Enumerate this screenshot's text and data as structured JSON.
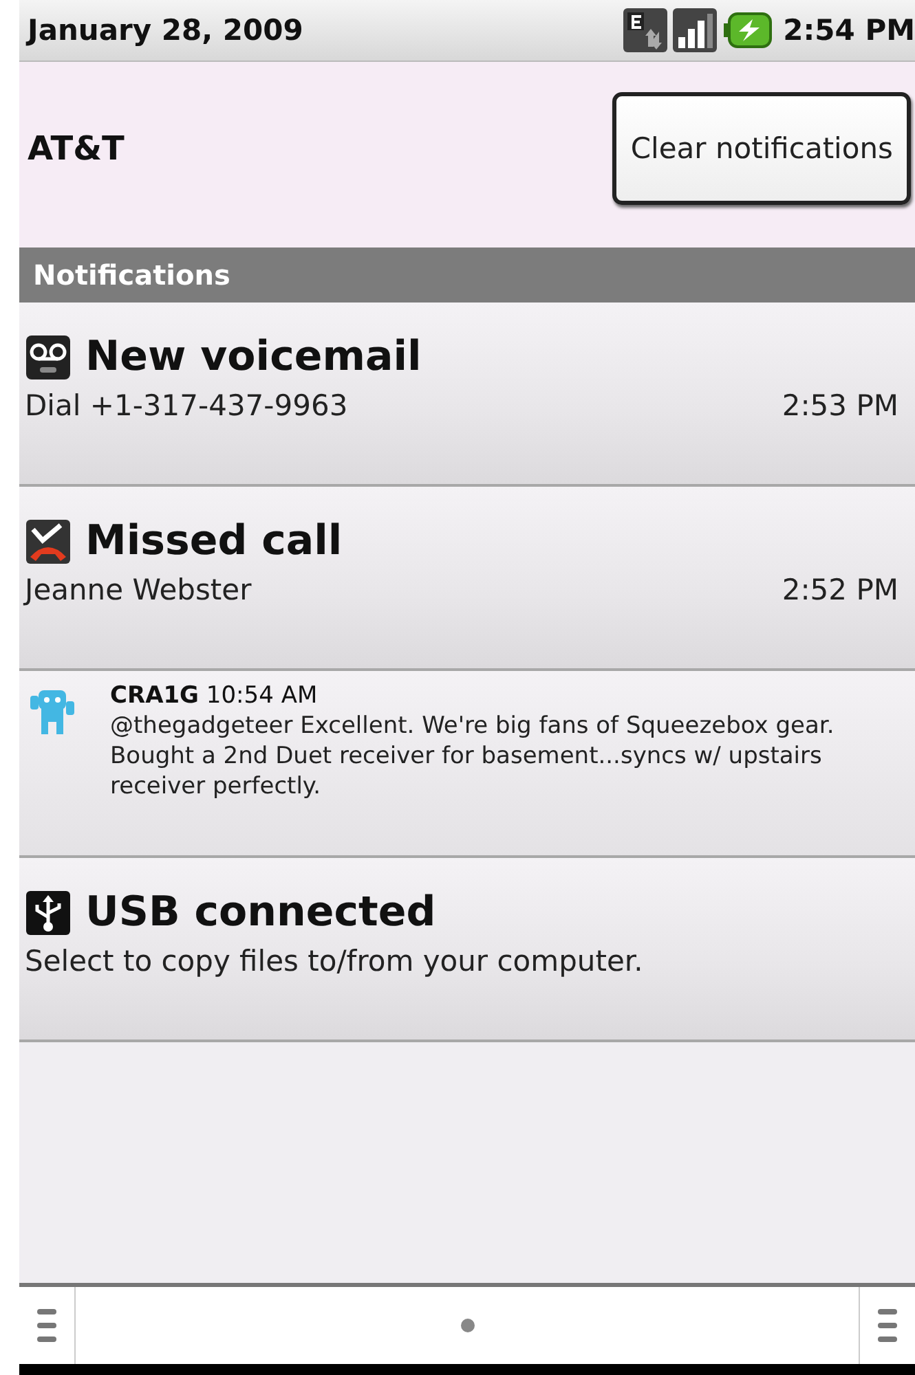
{
  "status_bar": {
    "date": "January 28, 2009",
    "time": "2:54 PM"
  },
  "carrier": "AT&T",
  "clear_button": "Clear notifications",
  "section_title": "Notifications",
  "notifications": [
    {
      "kind": "voicemail",
      "title": "New voicemail",
      "detail": "Dial +1-317-437-9963",
      "time": "2:53 PM"
    },
    {
      "kind": "missed_call",
      "title": "Missed call",
      "detail": "Jeanne Webster",
      "time": "2:52 PM"
    },
    {
      "kind": "tweet",
      "title": "CRA1G",
      "time": "10:54 AM",
      "detail": "@thegadgeteer Excellent. We're big fans of Squeezebox gear. Bought a 2nd Duet receiver for basement...syncs w/ upstairs receiver perfectly."
    },
    {
      "kind": "usb",
      "title": "USB connected",
      "detail": "Select to copy files to/from your computer."
    }
  ]
}
